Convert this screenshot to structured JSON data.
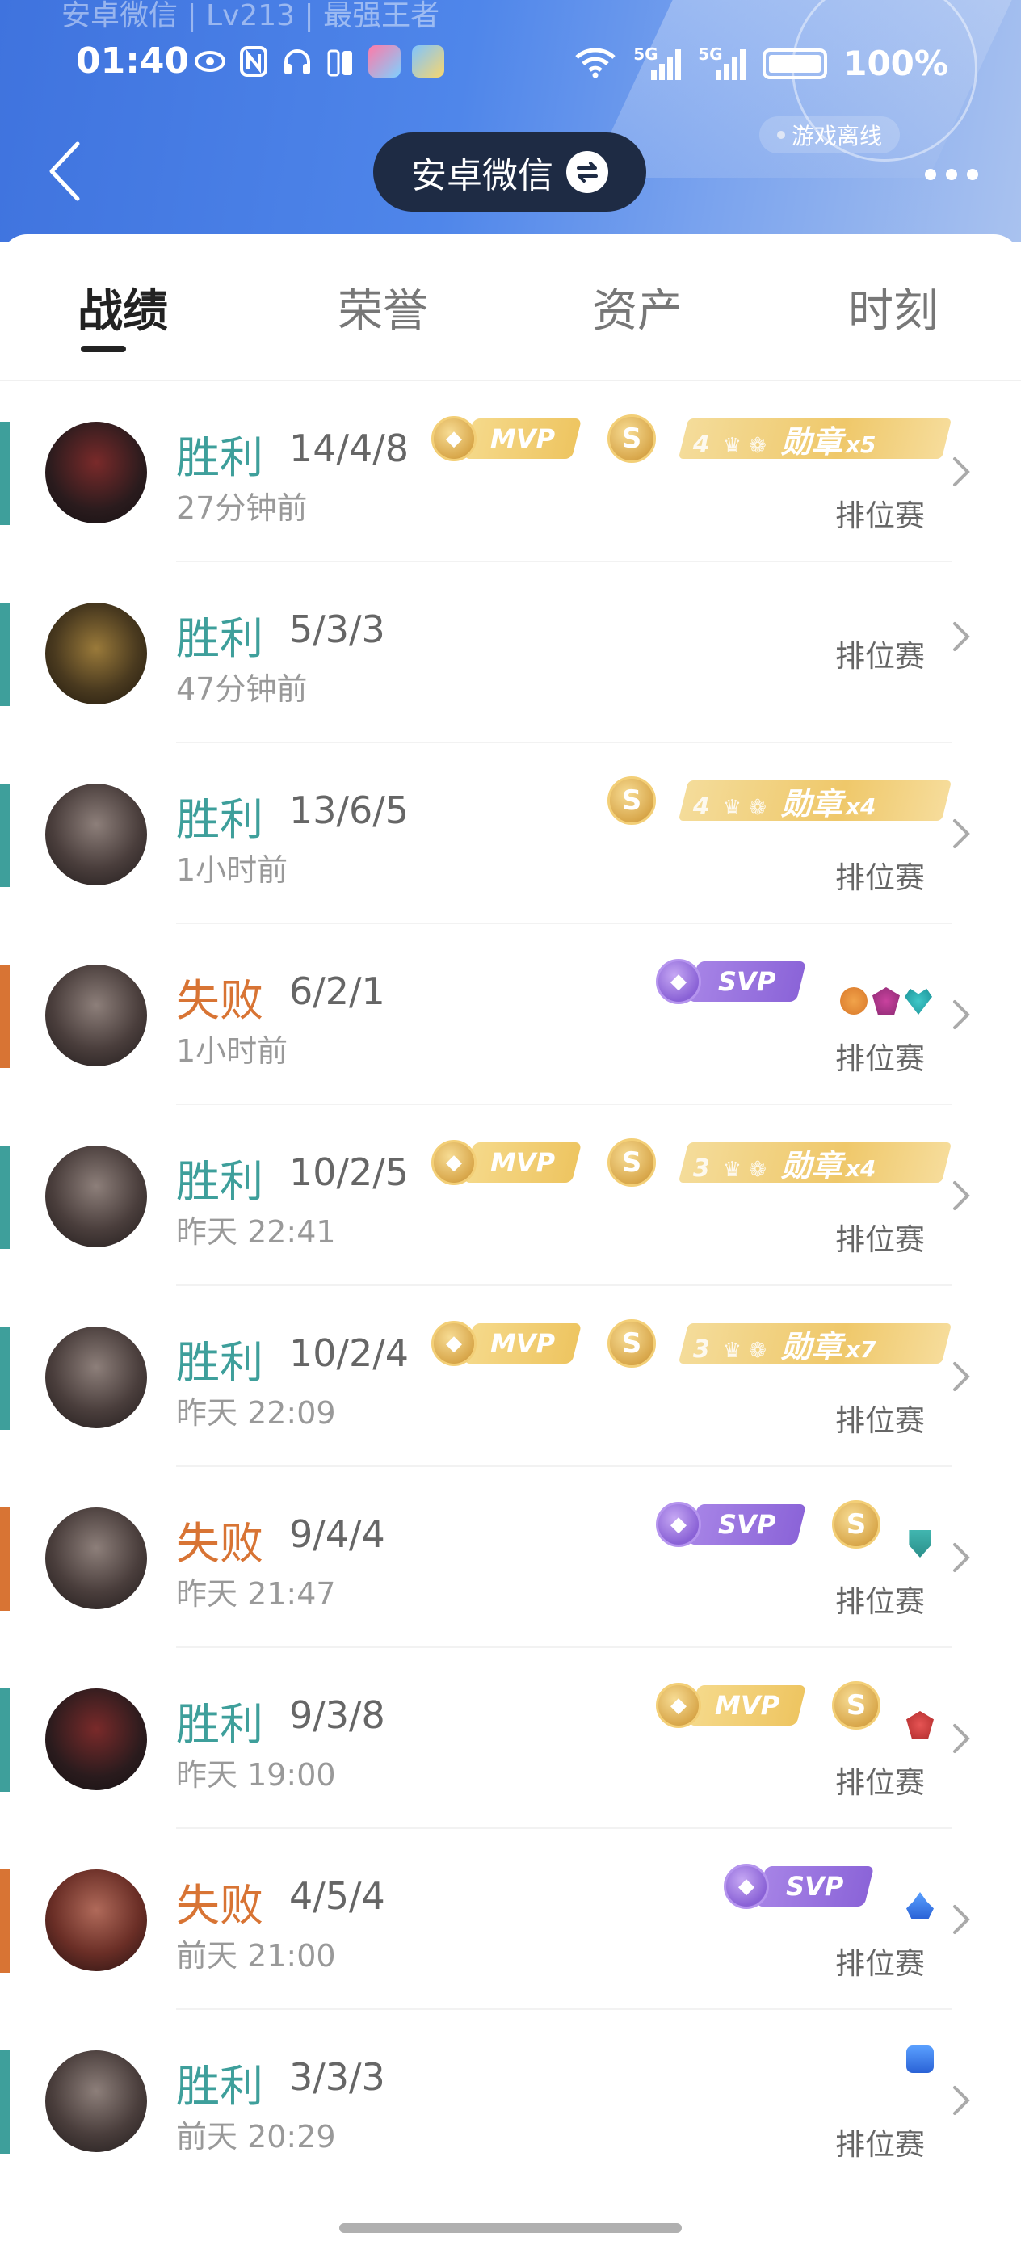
{
  "header": {
    "ghost_title": "安卓微信 | Lv213 | 最强王者",
    "account_label": "安卓微信",
    "offline_status": "游戏离线"
  },
  "status_bar": {
    "time": "01:40",
    "battery": "100%",
    "network_5g_1": "5G",
    "network_5g_2": "5G"
  },
  "tabs": [
    {
      "label": "战绩",
      "active": true
    },
    {
      "label": "荣誉",
      "active": false
    },
    {
      "label": "资产",
      "active": false
    },
    {
      "label": "时刻",
      "active": false
    }
  ],
  "colors": {
    "win": "#3e9f9b",
    "loss": "#d87434",
    "header_blue": "#4f86ea",
    "account_pill": "#1e2b44"
  },
  "matches": [
    {
      "result": "胜利",
      "outcome": "win",
      "kda": "14/4/8",
      "time": "27分钟前",
      "mode": "排位赛",
      "avatar": "dark-hero-avatar",
      "mvp": "MVP",
      "coin": "S",
      "medal_rank": "4",
      "medal": "勋章",
      "medal_count": "x5"
    },
    {
      "result": "胜利",
      "outcome": "win",
      "kda": "5/3/3",
      "time": "47分钟前",
      "mode": "排位赛",
      "avatar": "monster-hero-avatar"
    },
    {
      "result": "胜利",
      "outcome": "win",
      "kda": "13/6/5",
      "time": "1小时前",
      "mode": "排位赛",
      "avatar": "gray-hero-avatar",
      "coin": "S",
      "medal_rank": "4",
      "medal": "勋章",
      "medal_count": "x4"
    },
    {
      "result": "失败",
      "outcome": "loss",
      "kda": "6/2/1",
      "time": "1小时前",
      "mode": "排位赛",
      "avatar": "gray-hero-avatar",
      "svp": "SVP"
    },
    {
      "result": "胜利",
      "outcome": "win",
      "kda": "10/2/5",
      "time": "昨天 22:41",
      "mode": "排位赛",
      "avatar": "gray-hero-avatar",
      "mvp": "MVP",
      "coin": "S",
      "medal_rank": "3",
      "medal": "勋章",
      "medal_count": "x4"
    },
    {
      "result": "胜利",
      "outcome": "win",
      "kda": "10/2/4",
      "time": "昨天 22:09",
      "mode": "排位赛",
      "avatar": "gray-hero-avatar",
      "mvp": "MVP",
      "coin": "S",
      "medal_rank": "3",
      "medal": "勋章",
      "medal_count": "x7"
    },
    {
      "result": "失败",
      "outcome": "loss",
      "kda": "9/4/4",
      "time": "昨天 21:47",
      "mode": "排位赛",
      "avatar": "gray-hero-avatar",
      "svp": "SVP",
      "coin": "S"
    },
    {
      "result": "胜利",
      "outcome": "win",
      "kda": "9/3/8",
      "time": "昨天 19:00",
      "mode": "排位赛",
      "avatar": "dark-hero-avatar",
      "mvp": "MVP",
      "coin": "S"
    },
    {
      "result": "失败",
      "outcome": "loss",
      "kda": "4/5/4",
      "time": "前天 21:00",
      "mode": "排位赛",
      "avatar": "angry-hero-avatar",
      "svp": "SVP"
    },
    {
      "result": "胜利",
      "outcome": "win",
      "kda": "3/3/3",
      "time": "前天 20:29",
      "mode": "排位赛",
      "avatar": "gray-hero-avatar"
    }
  ]
}
